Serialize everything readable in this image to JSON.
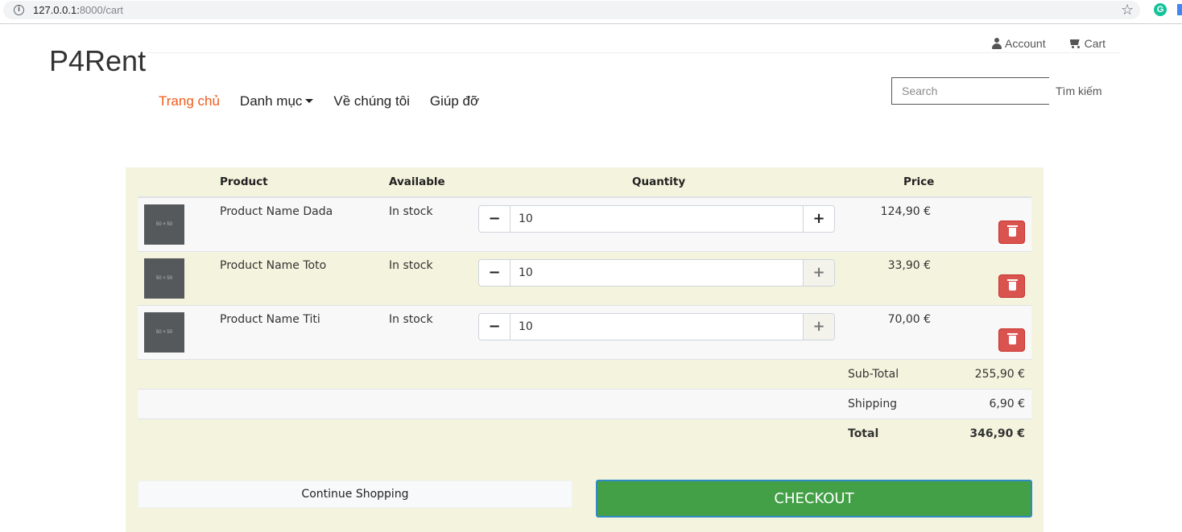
{
  "browser": {
    "url_host": "127.0.0.1:",
    "url_path": "8000/cart",
    "info_glyph": "i",
    "star_glyph": "☆",
    "grammarly_glyph": "G"
  },
  "header": {
    "brand": "P4Rent",
    "account_label": "Account",
    "cart_label": "Cart",
    "nav": [
      "Trang chủ",
      "Danh mục",
      "Về chúng tôi",
      "Giúp đỡ"
    ],
    "search_placeholder": "Search",
    "search_button": "Tìm kiếm"
  },
  "cart": {
    "columns": [
      "Product",
      "Available",
      "Quantity",
      "Price"
    ],
    "items": [
      {
        "thumb": "50 × 50",
        "name": "Product Name Dada",
        "availability": "In stock",
        "minus": "−",
        "plus": "+",
        "quantity": "10",
        "price": "124,90 €"
      },
      {
        "thumb": "50 × 50",
        "name": "Product Name Toto",
        "availability": "In stock",
        "minus": "−",
        "plus": "+",
        "quantity": "10",
        "price": "33,90 €"
      },
      {
        "thumb": "50 × 50",
        "name": "Product Name Titi",
        "availability": "In stock",
        "minus": "−",
        "plus": "+",
        "quantity": "10",
        "price": "70,00 €"
      }
    ],
    "subtotal_label": "Sub-Total",
    "subtotal_value": "255,90 €",
    "shipping_label": "Shipping",
    "shipping_value": "6,90 €",
    "total_label": "Total",
    "total_value": "346,90 €",
    "continue_label": "Continue Shopping",
    "checkout_label": "CHECKOUT"
  },
  "colors": {
    "accent_nav": "#f05a1a",
    "panel_bg": "#f4f4de",
    "checkout_green": "#43a047",
    "delete_red": "#d9534f"
  }
}
